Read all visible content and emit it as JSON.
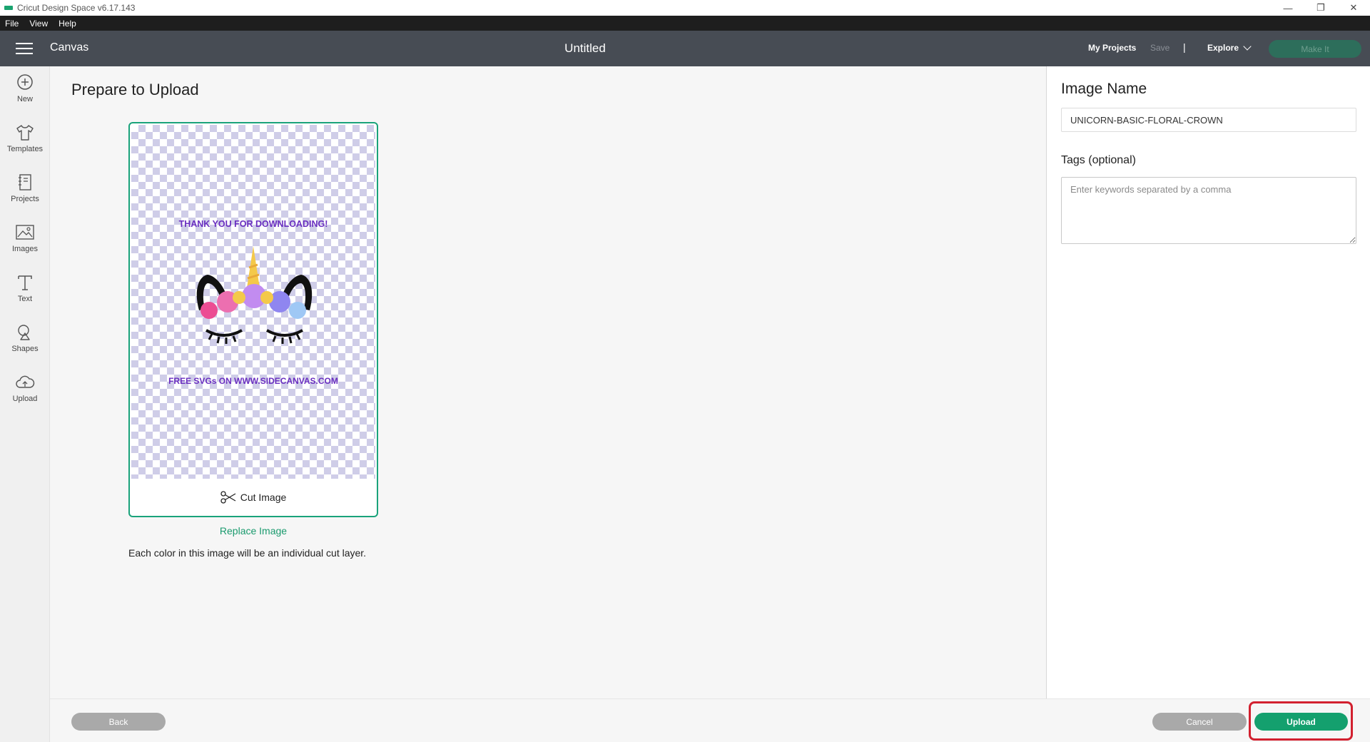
{
  "window": {
    "title": "Cricut Design Space  v6.17.143",
    "controls": [
      "—",
      "❐",
      "✕"
    ]
  },
  "menubar": [
    "File",
    "View",
    "Help"
  ],
  "header": {
    "section": "Canvas",
    "doc_title": "Untitled",
    "my_projects": "My Projects",
    "save": "Save",
    "separator": "|",
    "explore": "Explore",
    "make_it": "Make It"
  },
  "sidebar": [
    {
      "label": "New",
      "icon": "plus-circle-icon"
    },
    {
      "label": "Templates",
      "icon": "tshirt-icon"
    },
    {
      "label": "Projects",
      "icon": "notebook-icon"
    },
    {
      "label": "Images",
      "icon": "image-icon"
    },
    {
      "label": "Text",
      "icon": "text-icon"
    },
    {
      "label": "Shapes",
      "icon": "shapes-icon"
    },
    {
      "label": "Upload",
      "icon": "cloud-upload-icon"
    }
  ],
  "main": {
    "title": "Prepare to Upload",
    "art": {
      "top_text": "THANK YOU FOR DOWNLOADING!",
      "bottom_text": "FREE SVGs ON WWW.SIDECANVAS.COM"
    },
    "cut_label": "Cut Image",
    "replace_link": "Replace Image",
    "help_text": "Each color in this image will be an individual cut layer."
  },
  "right_panel": {
    "image_name_label": "Image Name",
    "image_name_value": "UNICORN-BASIC-FLORAL-CROWN",
    "tags_label": "Tags (optional)",
    "tags_placeholder": "Enter keywords separated by a comma"
  },
  "footer": {
    "back": "Back",
    "cancel": "Cancel",
    "upload": "Upload"
  },
  "colors": {
    "accent": "#14a06e",
    "header_bg": "#474c54",
    "highlight": "#d2202f",
    "art_text": "#6a2fc0"
  }
}
